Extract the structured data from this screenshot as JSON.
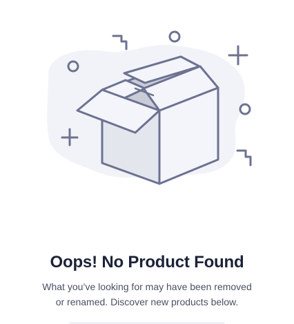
{
  "empty_state": {
    "title": "Oops! No Product Found",
    "description_line_1": "What you’ve looking for may have been removed",
    "description_line_2": "or renamed. Discover new products below.",
    "illustration": "empty-box-icon"
  },
  "colors": {
    "stroke": "#6c7291",
    "blob": "#f2f3f8",
    "box_front": "#f4f5fa",
    "box_side": "#e4e6ee",
    "box_inside": "#c9ccd7",
    "title": "#1c2338",
    "text": "#4a5064"
  }
}
